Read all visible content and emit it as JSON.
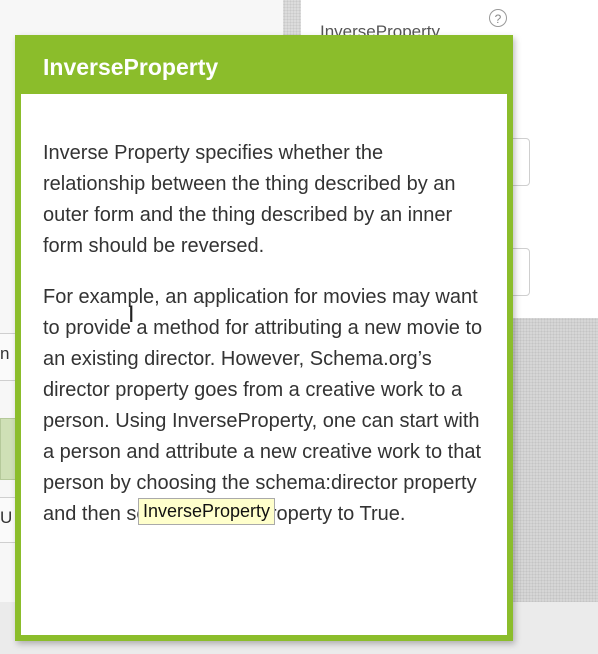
{
  "background": {
    "property_label": "InverseProperty",
    "help_icon_glyph": "?",
    "left_letters": [
      "n",
      "U"
    ]
  },
  "popup": {
    "title": "InverseProperty",
    "paragraph1": "Inverse Property specifies whether the relationship between the thing described by an outer form and the thing described by an inner form should be reversed.",
    "paragraph2": "For example, an application for movies may want to provide a method for attributing a new movie to an existing director. However, Schema.org’s director property goes from a creative work to a person. Using InverseProperty, one can start with a person and attribute a new creative work to that person by choosing the schema:director property and then setting InverseProperty to True.",
    "accent_color": "#8bbd2b"
  },
  "hover_tooltip": {
    "text": "InverseProperty"
  },
  "cursor": {
    "glyph": "I"
  }
}
